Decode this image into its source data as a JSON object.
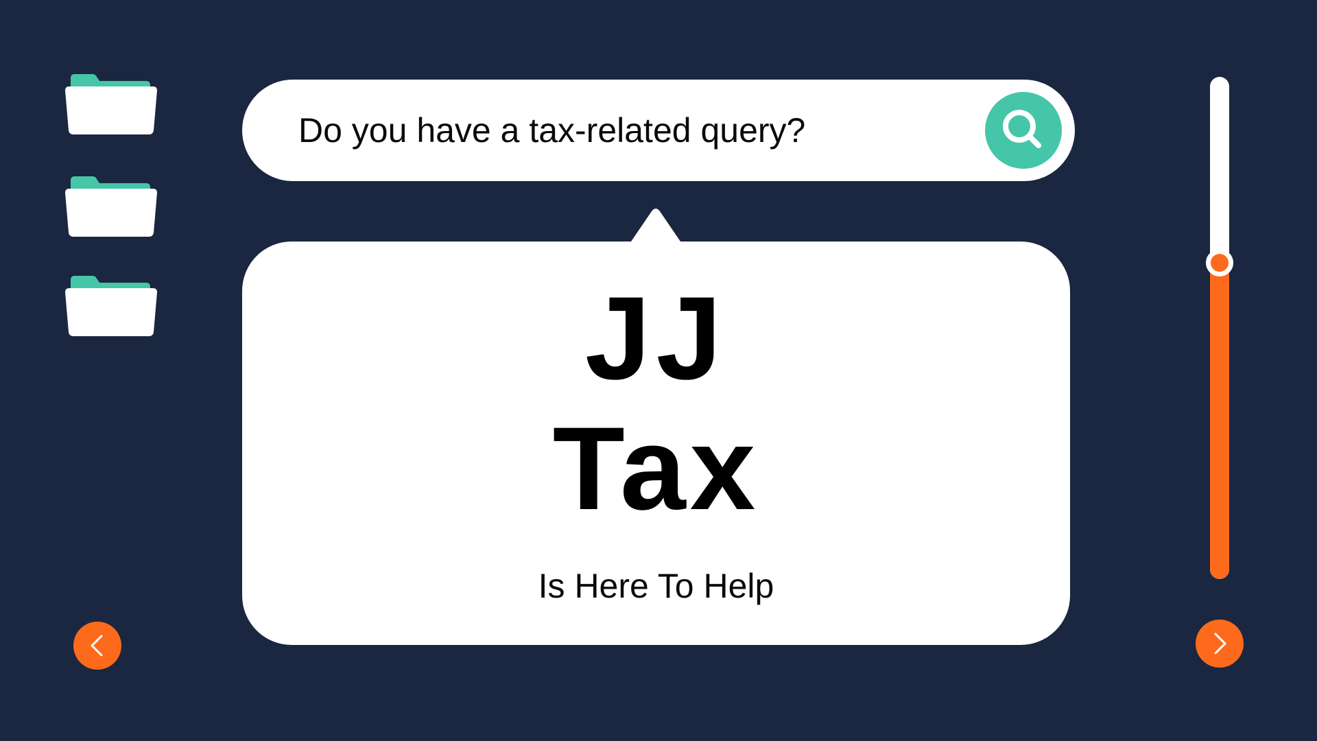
{
  "search": {
    "query_text": "Do you have a tax-related query?",
    "button_icon": "search-icon"
  },
  "sidebar": {
    "items": [
      {
        "icon": "folder-icon"
      },
      {
        "icon": "folder-icon"
      },
      {
        "icon": "folder-icon"
      }
    ]
  },
  "bubble": {
    "brand_line1": "JJ",
    "brand_line2": "Tax",
    "tagline": "Is Here To Help"
  },
  "slider": {
    "value_fraction": 0.63
  },
  "navigation": {
    "prev_icon": "chevron-left-icon",
    "next_icon": "chevron-right-icon"
  },
  "colors": {
    "background": "#1b2640",
    "accent_orange": "#fd6a1b",
    "accent_teal": "#45c6a8",
    "panel_white": "#ffffff"
  }
}
